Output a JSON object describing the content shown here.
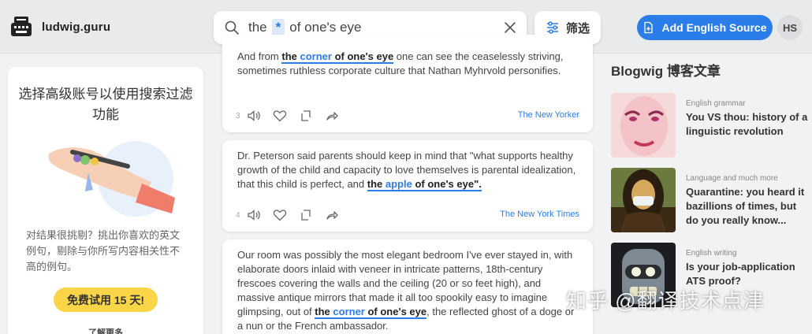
{
  "header": {
    "site_name": "ludwig.guru",
    "search": {
      "prefix": "the",
      "wildcard": "*",
      "suffix": "of one's eye"
    },
    "filter_label": "筛选",
    "add_source_label": "Add English Source",
    "avatar_initials": "HS"
  },
  "promo": {
    "title": "选择高级账号以使用搜索过滤功能",
    "text": "对结果很挑剔？挑出你喜欢的英文例句，剔除与你所写内容相关性不高的例句。",
    "button": "免费试用 15 天!",
    "more": "了解更多"
  },
  "results": [
    {
      "num": "3",
      "pre": "And from ",
      "hl_a": "the ",
      "hl_blue": "corner",
      "hl_b": " of one's eye",
      "post": " one can see the ceaselessly striving, sometimes ruthless corporate culture that Nathan Myhrvold personifies.",
      "source": "The New Yorker"
    },
    {
      "num": "4",
      "pre": "Dr. Peterson said parents should keep in mind that \"what supports healthy growth of the child and capacity to love themselves is parental idealization, that this child is perfect, and ",
      "hl_a": "the ",
      "hl_blue": "apple",
      "hl_b": " of one's eye\".",
      "post": "",
      "source": "The New York Times"
    },
    {
      "num": "",
      "pre": "Our room was possibly the most elegant bedroom I've ever stayed in, with elaborate doors inlaid with veneer in intricate patterns, 18th-century frescoes covering the walls and the ceiling (20 or so feet high), and massive antique mirrors that made it all too spookily easy to imagine glimpsing, out of ",
      "hl_a": "the ",
      "hl_blue": "corner",
      "hl_b": " of one's eye",
      "post": ", the reflected ghost of a doge or a nun or the French ambassador.",
      "source": ""
    }
  ],
  "blog": {
    "title": "Blogwig 博客文章",
    "items": [
      {
        "category": "English grammar",
        "headline": "You VS thou: history of a linguistic revolution"
      },
      {
        "category": "Language and much more",
        "headline": "Quarantine: you heard it bazillions of times, but do you really know..."
      },
      {
        "category": "English writing",
        "headline": "Is your job-application ATS proof?"
      }
    ]
  },
  "watermark": "知乎 @翻译技术点津",
  "colors": {
    "accent": "#2b7de9",
    "promo_button": "#f9d547",
    "background": "#f1f2f4"
  }
}
